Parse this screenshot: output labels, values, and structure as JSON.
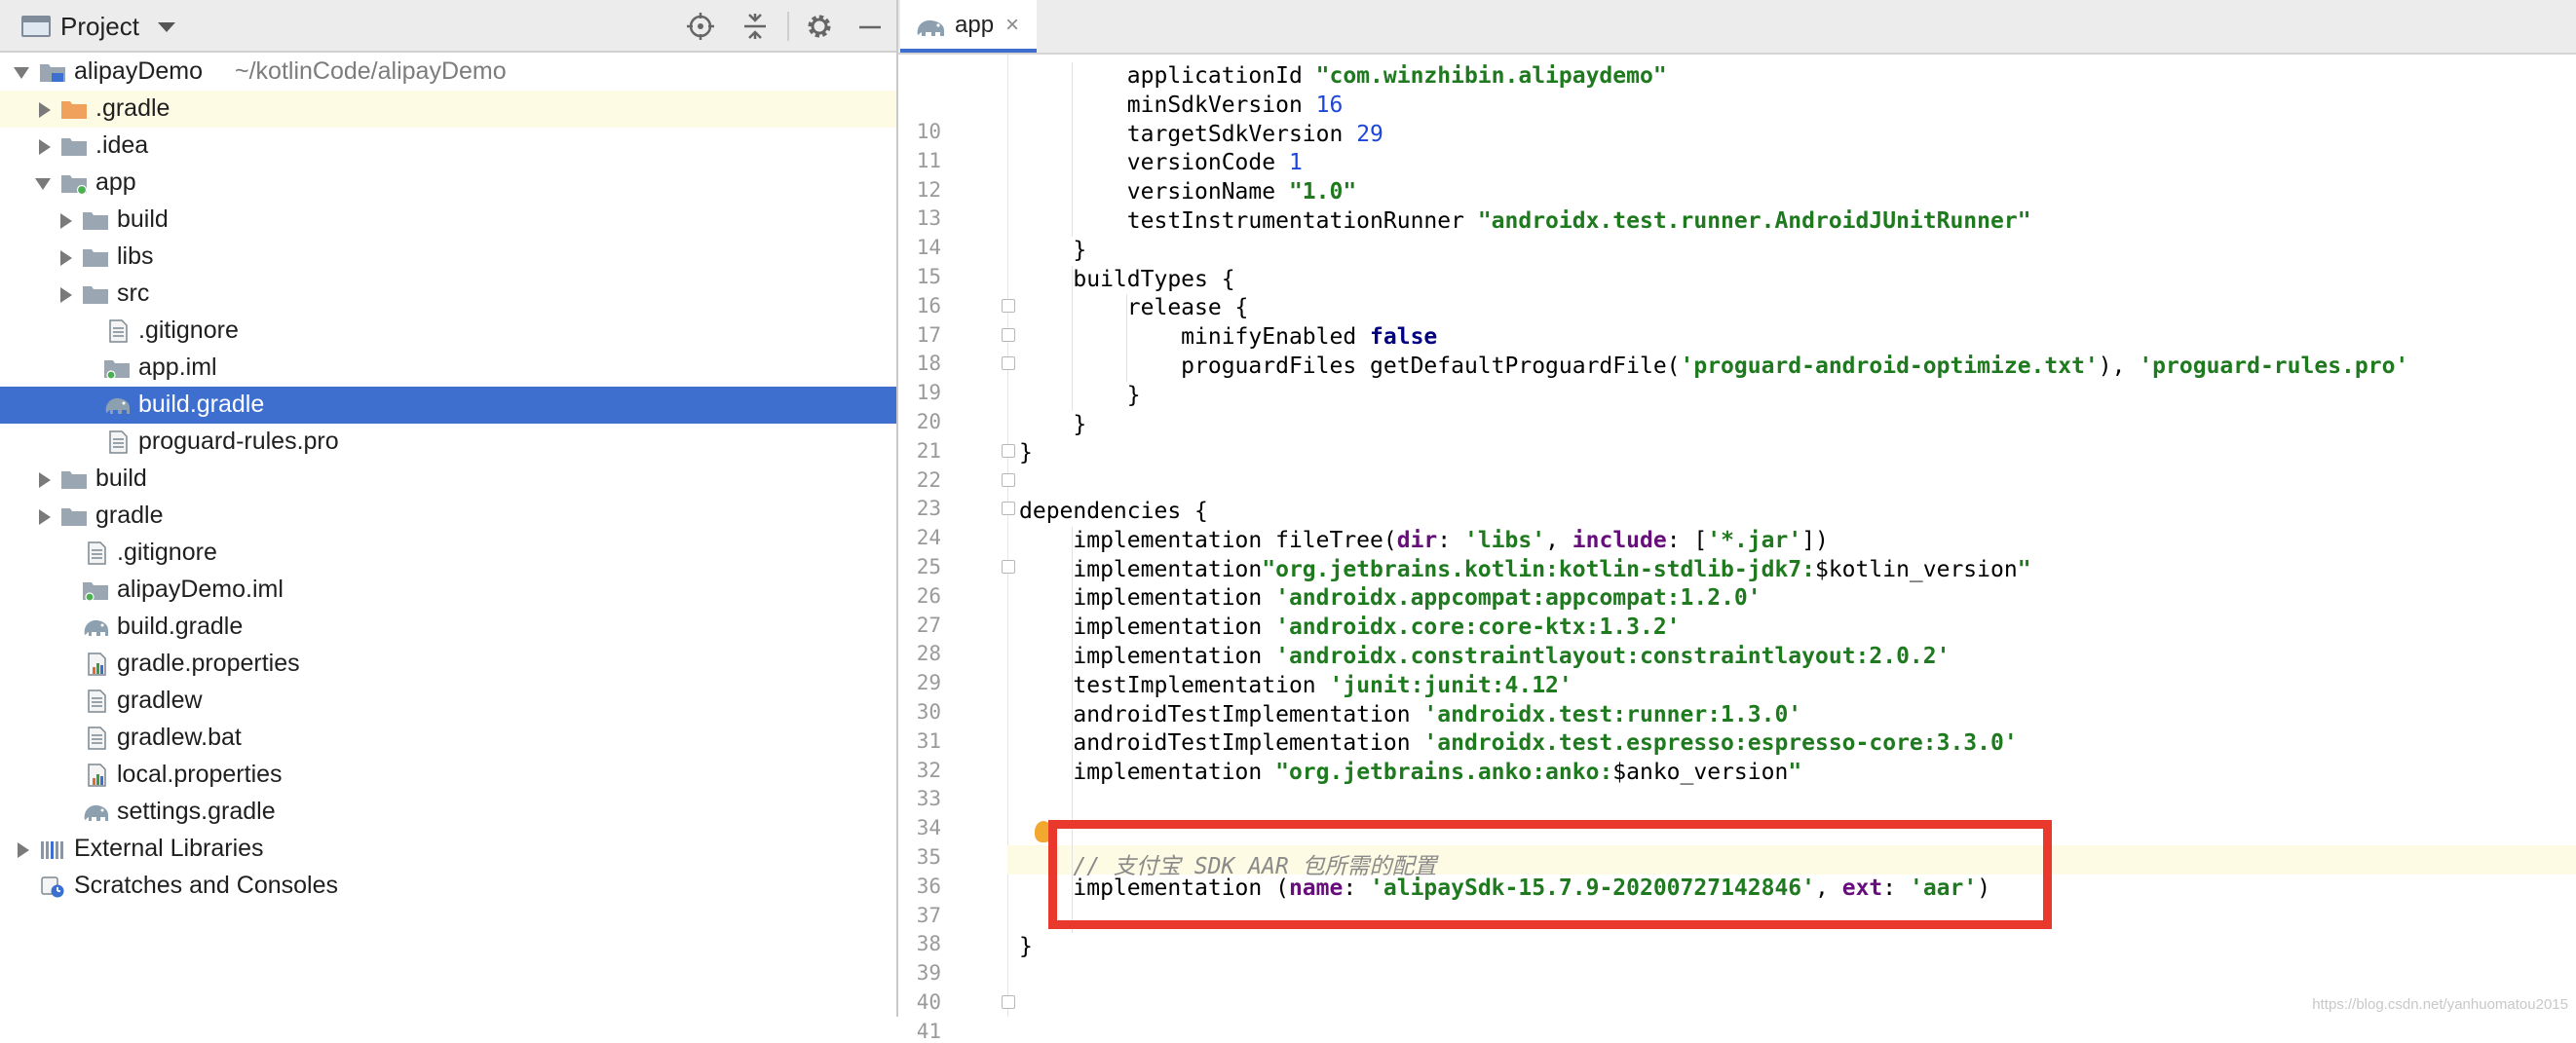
{
  "project_panel": {
    "title": "Project",
    "root": {
      "label": "alipayDemo",
      "path": "~/kotlinCode/alipayDemo"
    },
    "tree": [
      {
        "label": ".gradle",
        "indent": 1,
        "arrow": "right",
        "icon": "folder-orange-icon",
        "highlight": true
      },
      {
        "label": ".idea",
        "indent": 1,
        "arrow": "right",
        "icon": "folder-icon"
      },
      {
        "label": "app",
        "indent": 1,
        "arrow": "down",
        "icon": "module-folder-icon"
      },
      {
        "label": "build",
        "indent": 2,
        "arrow": "right",
        "icon": "folder-icon"
      },
      {
        "label": "libs",
        "indent": 2,
        "arrow": "right",
        "icon": "folder-icon"
      },
      {
        "label": "src",
        "indent": 2,
        "arrow": "right",
        "icon": "folder-icon"
      },
      {
        "label": ".gitignore",
        "indent": 3,
        "icon": "text-file-icon"
      },
      {
        "label": "app.iml",
        "indent": 3,
        "icon": "iml-file-icon"
      },
      {
        "label": "build.gradle",
        "indent": 3,
        "icon": "gradle-elephant-icon",
        "selected": true
      },
      {
        "label": "proguard-rules.pro",
        "indent": 3,
        "icon": "text-file-icon"
      },
      {
        "label": "build",
        "indent": 1,
        "arrow": "right",
        "icon": "folder-icon"
      },
      {
        "label": "gradle",
        "indent": 1,
        "arrow": "right",
        "icon": "folder-icon"
      },
      {
        "label": ".gitignore",
        "indent": 2,
        "icon": "text-file-icon"
      },
      {
        "label": "alipayDemo.iml",
        "indent": 2,
        "icon": "iml-file-icon"
      },
      {
        "label": "build.gradle",
        "indent": 2,
        "icon": "gradle-elephant-icon"
      },
      {
        "label": "gradle.properties",
        "indent": 2,
        "icon": "properties-file-icon"
      },
      {
        "label": "gradlew",
        "indent": 2,
        "icon": "text-file-icon"
      },
      {
        "label": "gradlew.bat",
        "indent": 2,
        "icon": "text-file-icon"
      },
      {
        "label": "local.properties",
        "indent": 2,
        "icon": "properties-file-icon"
      },
      {
        "label": "settings.gradle",
        "indent": 2,
        "icon": "gradle-elephant-icon"
      },
      {
        "label": "External Libraries",
        "indent": 0,
        "arrow": "right",
        "icon": "libraries-icon"
      },
      {
        "label": "Scratches and Consoles",
        "indent": 0,
        "icon": "scratches-icon"
      }
    ]
  },
  "editor": {
    "tab_label": "app",
    "lines": [
      {
        "n": "10",
        "code": [
          [
            "t",
            "        applicationId "
          ],
          [
            "str",
            "\"com.winzhibin.alipaydemo\""
          ]
        ]
      },
      {
        "n": "11",
        "code": [
          [
            "t",
            "        minSdkVersion "
          ],
          [
            "num",
            "16"
          ]
        ]
      },
      {
        "n": "12",
        "code": [
          [
            "t",
            "        targetSdkVersion "
          ],
          [
            "num",
            "29"
          ]
        ]
      },
      {
        "n": "13",
        "code": [
          [
            "t",
            "        versionCode "
          ],
          [
            "num",
            "1"
          ]
        ]
      },
      {
        "n": "14",
        "code": [
          [
            "t",
            "        versionName "
          ],
          [
            "str",
            "\"1.0\""
          ]
        ]
      },
      {
        "n": "15",
        "code": [
          [
            "t",
            "        testInstrumentationRunner "
          ],
          [
            "str",
            "\"androidx.test.runner.AndroidJUnitRunner\""
          ]
        ]
      },
      {
        "n": "16",
        "code": [
          [
            "t",
            "    }"
          ]
        ]
      },
      {
        "n": "17",
        "code": [
          [
            "t",
            "    buildTypes {"
          ]
        ]
      },
      {
        "n": "18",
        "code": [
          [
            "t",
            "        release {"
          ]
        ]
      },
      {
        "n": "19",
        "code": [
          [
            "t",
            "            minifyEnabled "
          ],
          [
            "kw",
            "false"
          ]
        ]
      },
      {
        "n": "20",
        "code": [
          [
            "t",
            "            proguardFiles getDefaultProguardFile("
          ],
          [
            "str",
            "'proguard-android-optimize.txt'"
          ],
          [
            "t",
            "), "
          ],
          [
            "str",
            "'proguard-rules.pro'"
          ]
        ]
      },
      {
        "n": "21",
        "code": [
          [
            "t",
            "        }"
          ]
        ]
      },
      {
        "n": "22",
        "code": [
          [
            "t",
            "    }"
          ]
        ]
      },
      {
        "n": "23",
        "code": [
          [
            "t",
            "}"
          ]
        ]
      },
      {
        "n": "24",
        "code": [
          [
            "t",
            ""
          ]
        ]
      },
      {
        "n": "25",
        "code": [
          [
            "t",
            "dependencies {"
          ]
        ]
      },
      {
        "n": "26",
        "code": [
          [
            "t",
            "    implementation fileTree("
          ],
          [
            "pn",
            "dir"
          ],
          [
            "t",
            ": "
          ],
          [
            "str",
            "'libs'"
          ],
          [
            "t",
            ", "
          ],
          [
            "pn",
            "include"
          ],
          [
            "t",
            ": ["
          ],
          [
            "str",
            "'*.jar'"
          ],
          [
            "t",
            "])"
          ]
        ]
      },
      {
        "n": "27",
        "code": [
          [
            "t",
            "    implementation"
          ],
          [
            "str",
            "\"org.jetbrains.kotlin:kotlin-stdlib-jdk7:"
          ],
          [
            "t",
            "$kotlin_version"
          ],
          [
            "str",
            "\""
          ]
        ]
      },
      {
        "n": "28",
        "code": [
          [
            "t",
            "    implementation "
          ],
          [
            "str",
            "'androidx.appcompat:appcompat:1.2.0'"
          ]
        ]
      },
      {
        "n": "29",
        "code": [
          [
            "t",
            "    implementation "
          ],
          [
            "str",
            "'androidx.core:core-ktx:1.3.2'"
          ]
        ]
      },
      {
        "n": "30",
        "code": [
          [
            "t",
            "    implementation "
          ],
          [
            "str",
            "'androidx.constraintlayout:constraintlayout:2.0.2'"
          ]
        ]
      },
      {
        "n": "31",
        "code": [
          [
            "t",
            "    testImplementation "
          ],
          [
            "str",
            "'junit:junit:4.12'"
          ]
        ]
      },
      {
        "n": "32",
        "code": [
          [
            "t",
            "    androidTestImplementation "
          ],
          [
            "str",
            "'androidx.test:runner:1.3.0'"
          ]
        ]
      },
      {
        "n": "33",
        "code": [
          [
            "t",
            "    androidTestImplementation "
          ],
          [
            "str",
            "'androidx.test.espresso:espresso-core:3.3.0'"
          ]
        ]
      },
      {
        "n": "34",
        "code": [
          [
            "t",
            "    implementation "
          ],
          [
            "str",
            "\"org.jetbrains.anko:anko:"
          ],
          [
            "t",
            "$anko_version"
          ],
          [
            "str",
            "\""
          ]
        ]
      },
      {
        "n": "35",
        "code": [
          [
            "t",
            ""
          ]
        ]
      },
      {
        "n": "36",
        "code": [
          [
            "t",
            ""
          ]
        ]
      },
      {
        "n": "37",
        "code": [
          [
            "cmt",
            "    // 支付宝 SDK AAR 包所需的配置"
          ]
        ]
      },
      {
        "n": "38",
        "code": [
          [
            "t",
            "    implementation ("
          ],
          [
            "pn",
            "name"
          ],
          [
            "t",
            ": "
          ],
          [
            "str",
            "'alipaySdk-15.7.9-20200727142846'"
          ],
          [
            "t",
            ", "
          ],
          [
            "pn",
            "ext"
          ],
          [
            "t",
            ": "
          ],
          [
            "str",
            "'aar'"
          ],
          [
            "t",
            ")"
          ]
        ]
      },
      {
        "n": "39",
        "code": [
          [
            "t",
            ""
          ]
        ]
      },
      {
        "n": "40",
        "code": [
          [
            "t",
            "}"
          ]
        ]
      },
      {
        "n": "41",
        "code": [
          [
            "t",
            ""
          ]
        ]
      }
    ]
  },
  "watermark": "https://blog.csdn.net/yanhuomatou2015",
  "colors": {
    "selection": "#3e6fcf",
    "annotation_box": "#e8392c",
    "string": "#1f7a1f",
    "number": "#1c46d8"
  }
}
